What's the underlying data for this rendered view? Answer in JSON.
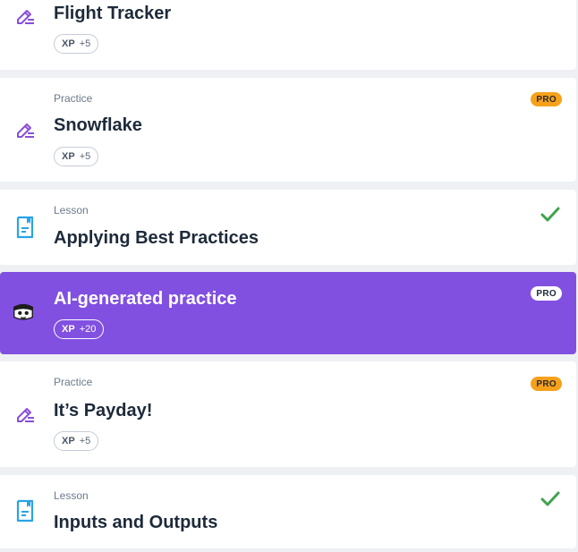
{
  "items": [
    {
      "type_label": "",
      "title": "Flight Tracker",
      "icon": "pencil-icon",
      "xp_label": "XP",
      "xp_value": "+5",
      "badge": ""
    },
    {
      "type_label": "Practice",
      "title": "Snowflake",
      "icon": "pencil-icon",
      "xp_label": "XP",
      "xp_value": "+5",
      "badge": "PRO"
    },
    {
      "type_label": "Lesson",
      "title": "Applying Best Practices",
      "icon": "lesson-icon",
      "completed": true
    },
    {
      "type_label": "",
      "title": "AI-generated practice",
      "icon": "robot-icon",
      "xp_label": "XP",
      "xp_value": "+20",
      "badge": "PRO"
    },
    {
      "type_label": "Practice",
      "title": "It’s Payday!",
      "icon": "pencil-icon",
      "xp_label": "XP",
      "xp_value": "+5",
      "badge": "PRO"
    },
    {
      "type_label": "Lesson",
      "title": "Inputs and Outputs",
      "icon": "lesson-icon",
      "completed": true
    }
  ],
  "colors": {
    "practice_icon": "#8a4fd8",
    "lesson_icon": "#2aa3e6",
    "ai_background": "#8150e0",
    "pro_badge": "#f6a11b",
    "check": "#3fa34d"
  }
}
